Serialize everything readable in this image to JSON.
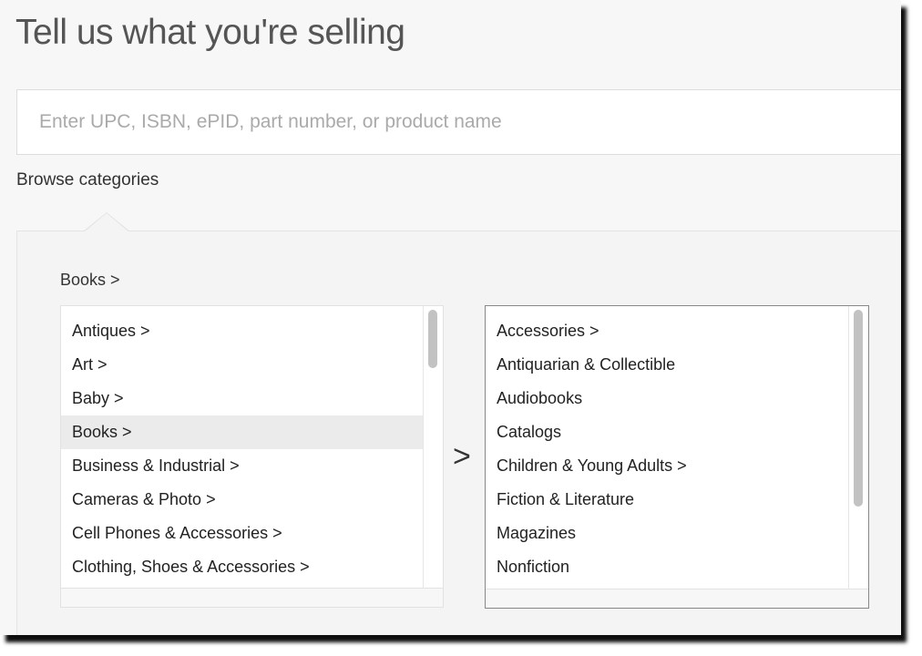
{
  "header": {
    "title": "Tell us what you're selling"
  },
  "search": {
    "placeholder": "Enter UPC, ISBN, ePID, part number, or product name",
    "value": ""
  },
  "browse": {
    "label": "Browse categories",
    "breadcrumb": "Books >",
    "separator": ">",
    "left_list": [
      {
        "label": "Antiques >",
        "selected": false
      },
      {
        "label": "Art >",
        "selected": false
      },
      {
        "label": "Baby >",
        "selected": false
      },
      {
        "label": "Books >",
        "selected": true
      },
      {
        "label": "Business & Industrial >",
        "selected": false
      },
      {
        "label": "Cameras & Photo >",
        "selected": false
      },
      {
        "label": "Cell Phones & Accessories >",
        "selected": false
      },
      {
        "label": "Clothing, Shoes & Accessories >",
        "selected": false
      }
    ],
    "right_list": [
      {
        "label": "Accessories >",
        "selected": false
      },
      {
        "label": "Antiquarian & Collectible",
        "selected": false
      },
      {
        "label": "Audiobooks",
        "selected": false
      },
      {
        "label": "Catalogs",
        "selected": false
      },
      {
        "label": "Children & Young Adults >",
        "selected": false
      },
      {
        "label": "Fiction & Literature",
        "selected": false
      },
      {
        "label": "Magazines",
        "selected": false
      },
      {
        "label": "Nonfiction",
        "selected": false
      }
    ]
  }
}
